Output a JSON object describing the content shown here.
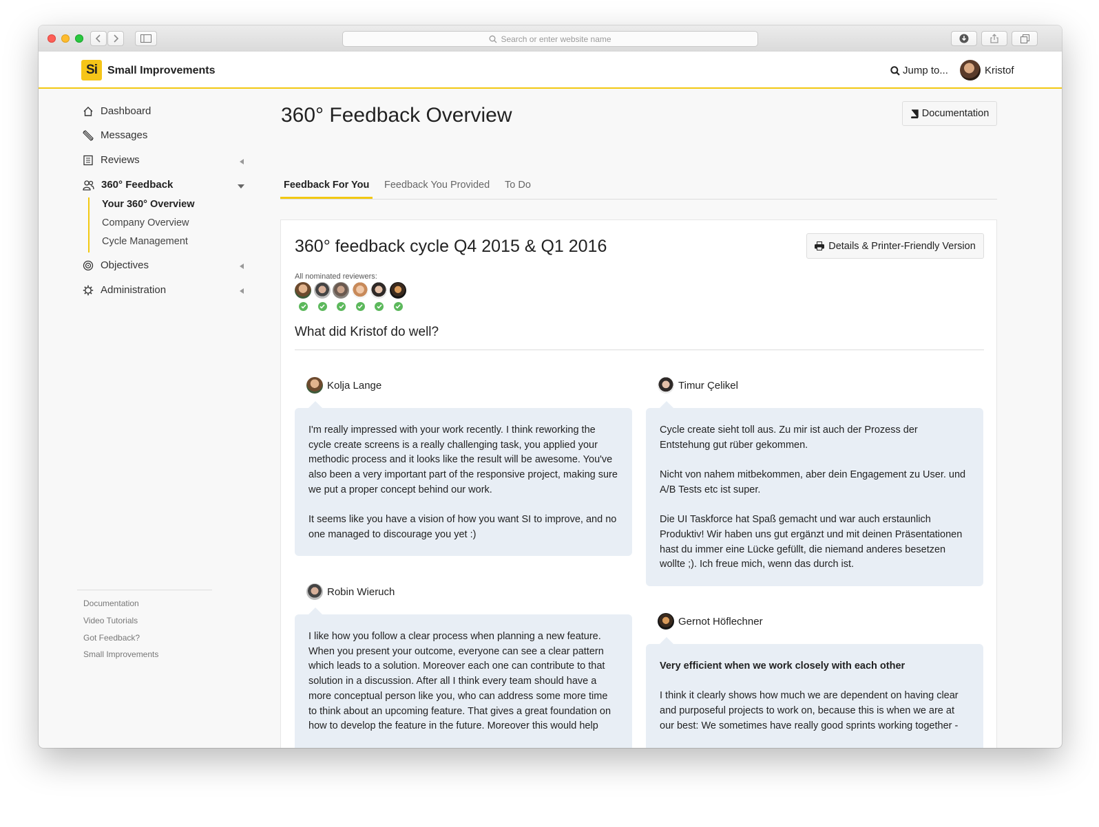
{
  "browser": {
    "url_placeholder": "Search or enter website name"
  },
  "app": {
    "logo_text": "Si",
    "name": "Small Improvements",
    "jump_label": "Jump to...",
    "user_name": "Kristof",
    "accent_color": "#f2c811"
  },
  "sidebar": {
    "items": [
      {
        "label": "Dashboard",
        "icon": "home-icon"
      },
      {
        "label": "Messages",
        "icon": "pencil-icon"
      },
      {
        "label": "Reviews",
        "icon": "document-icon"
      },
      {
        "label": "360° Feedback",
        "icon": "people-icon"
      },
      {
        "label": "Objectives",
        "icon": "target-icon"
      },
      {
        "label": "Administration",
        "icon": "gear-icon"
      }
    ],
    "subitems": [
      "Your 360° Overview",
      "Company Overview",
      "Cycle Management"
    ],
    "footer_links": [
      "Documentation",
      "Video Tutorials",
      "Got Feedback?",
      "Small Improvements"
    ]
  },
  "main": {
    "title": "360° Feedback Overview",
    "doc_button": "Documentation",
    "tabs": [
      "Feedback For You",
      "Feedback You Provided",
      "To Do"
    ],
    "cycle": {
      "title": "360° feedback cycle Q4 2015 & Q1 2016",
      "print_button": "Details & Printer-Friendly Version",
      "nominated_label": "All nominated reviewers:",
      "reviewer_count": 6,
      "question": "What did Kristof do well?"
    },
    "feedback": [
      {
        "name": "Kolja Lange",
        "paragraphs": [
          "I'm really impressed with your work recently. I think reworking the cycle create screens is a really challenging task, you applied your methodic process and it looks like the result will be awesome. You've also been a very important part of the responsive project, making sure we put a proper concept behind our work.",
          "It seems like you have a vision of how you want SI to improve, and no one managed to discourage you yet :)"
        ]
      },
      {
        "name": "Timur Çelikel",
        "paragraphs": [
          "Cycle create sieht toll aus. Zu mir ist auch der Prozess der Entstehung gut rüber gekommen.",
          "Nicht von nahem mitbekommen, aber dein Engagement zu User. und A/B Tests etc ist super.",
          "Die UI Taskforce hat Spaß gemacht und war auch erstaunlich Produktiv! Wir haben uns gut ergänzt und mit deinen Präsentationen hast du immer eine Lücke gefüllt, die niemand anderes besetzen wollte ;). Ich freue mich, wenn das durch ist."
        ]
      },
      {
        "name": "Robin Wieruch",
        "paragraphs": [
          "I like how you follow a clear process when planning a new feature. When you present your outcome, everyone can see a clear pattern which leads to a solution. Moreover each one can contribute to that solution in a discussion. After all I think every team should have a more conceptual person like you, who can address some more time to think about an upcoming feature. That gives a great foundation on how to develop the feature in the future. Moreover this would help"
        ]
      },
      {
        "name": "Gernot Höflechner",
        "heading": "Very efficient when we work closely with each other",
        "paragraphs": [
          "I think it clearly shows how much we are dependent on having clear and purposeful projects to work on, because this is when we are at our best: We sometimes have really good sprints working together -"
        ]
      }
    ]
  }
}
